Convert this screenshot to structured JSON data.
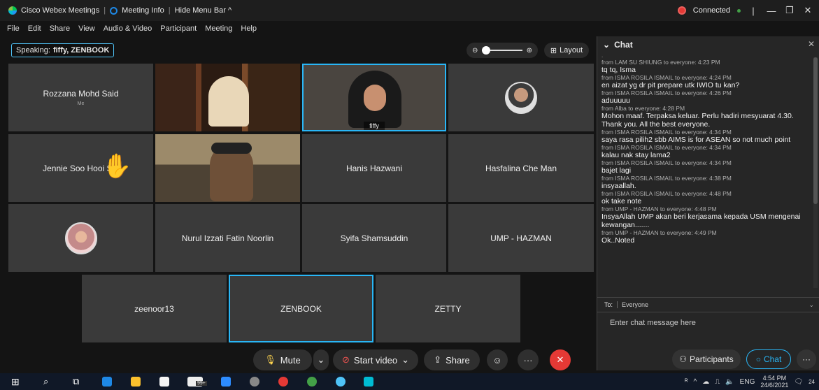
{
  "titlebar": {
    "app": "Cisco Webex Meetings",
    "meeting_info": "Meeting Info",
    "hide_menu": "Hide Menu Bar ^",
    "status": "Connected",
    "colors": {
      "status_red": "#e53935",
      "status_green": "#43a047"
    }
  },
  "menu": [
    "File",
    "Edit",
    "Share",
    "View",
    "Audio & Video",
    "Participant",
    "Meeting",
    "Help"
  ],
  "speaking": {
    "label": "Speaking:",
    "names": "fiffy, ZENBOOK"
  },
  "layout_label": "Layout",
  "tiles": {
    "rozzana": {
      "name": "Rozzana Mohd Said",
      "sub": "Me"
    },
    "fiffy": {
      "name": "fiffy"
    },
    "jennie": {
      "name": "Jennie Soo Hooi Sin"
    },
    "hanis": {
      "name": "Hanis Hazwani"
    },
    "hasfalina": {
      "name": "Hasfalina Che Man"
    },
    "nurul": {
      "name": "Nurul Izzati Fatin Noorlin"
    },
    "syifa": {
      "name": "Syifa Shamsuddin"
    },
    "ump": {
      "name": "UMP - HAZMAN"
    },
    "zeenoor": {
      "name": "zeenoor13"
    },
    "zenbook": {
      "name": "ZENBOOK"
    },
    "zetty": {
      "name": "ZETTY"
    }
  },
  "toolbar": {
    "mute": "Mute",
    "start_video": "Start video",
    "share": "Share",
    "more": "···",
    "colors": {
      "end": "#e53935",
      "active": "#29b6f6"
    }
  },
  "chat": {
    "title": "Chat",
    "messages": [
      {
        "from": "from LAM SU SHIUNG to everyone:  4:23 PM",
        "text": "tq tq, Isma"
      },
      {
        "from": "from ISMA ROSILA ISMAIL to everyone:  4:24 PM",
        "text": "en aizat yg dr pit prepare utk IWIO tu kan?"
      },
      {
        "from": "from ISMA ROSILA ISMAIL to everyone:  4:26 PM",
        "text": "aduuuuu"
      },
      {
        "from": "from Alba to everyone:  4:28 PM",
        "text": "Mohon maaf.  Terpaksa keluar.  Perlu hadiri mesyuarat 4.30.  Thank you.  All the best everyone."
      },
      {
        "from": "from ISMA ROSILA ISMAIL to everyone:  4:34 PM",
        "text": "saya rasa pilih2 sbb AIMS is for ASEAN so not much point"
      },
      {
        "from": "from ISMA ROSILA ISMAIL to everyone:  4:34 PM",
        "text": "kalau nak stay lama2"
      },
      {
        "from": "from ISMA ROSILA ISMAIL to everyone:  4:34 PM",
        "text": "bajet lagi"
      },
      {
        "from": "from ISMA ROSILA ISMAIL to everyone:  4:38 PM",
        "text": "insyaallah."
      },
      {
        "from": "from ISMA ROSILA ISMAIL to everyone:  4:48 PM",
        "text": "ok take note"
      },
      {
        "from": "from UMP - HAZMAN to everyone:  4:48 PM",
        "text": "InsyaAllah UMP akan beri kerjasama kepada USM mengenai kewangan......."
      },
      {
        "from": "from UMP - HAZMAN to everyone:  4:49 PM",
        "text": "Ok..Noted"
      }
    ],
    "to_label": "To:",
    "to_value": "Everyone",
    "input_placeholder": "Enter chat message here",
    "participants_label": "Participants",
    "chat_label": "Chat",
    "more": "···"
  },
  "taskbar": {
    "tray_lang": "ENG",
    "time": "4:54 PM",
    "date": "24/6/2021",
    "badge_99": "99+",
    "notif": "24"
  }
}
